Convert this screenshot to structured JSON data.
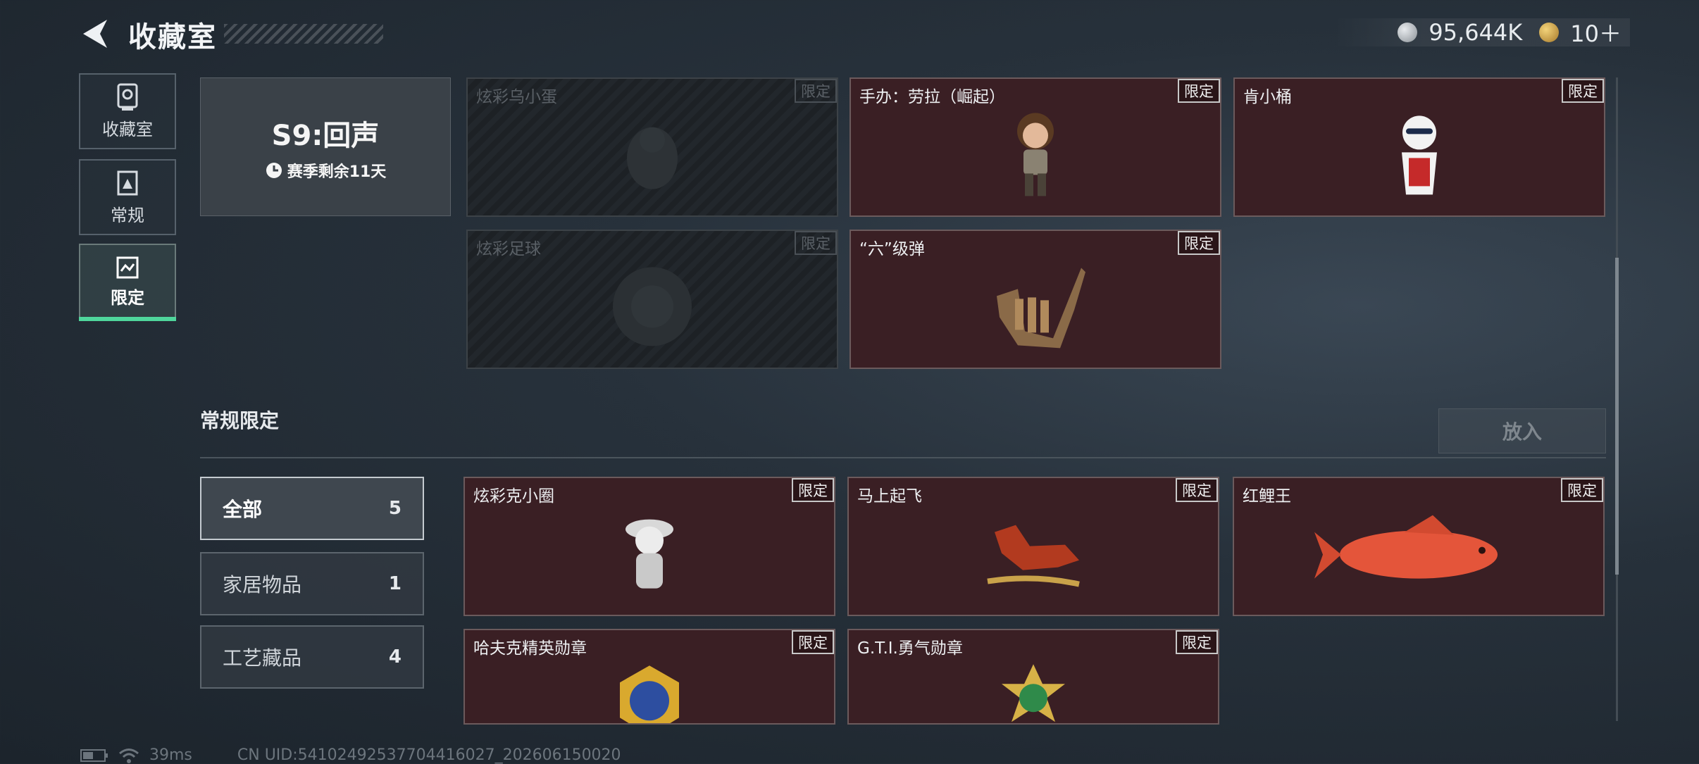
{
  "header": {
    "title": "收藏室",
    "currency": [
      {
        "icon": "silver-coin-icon",
        "value": "95,644K",
        "color": "#b8bcc0"
      },
      {
        "icon": "gold-coin-icon",
        "value": "10＋",
        "color": "#d4a94a"
      }
    ]
  },
  "sidebar": {
    "items": [
      {
        "label": "收藏室",
        "icon": "trophy-icon"
      },
      {
        "label": "常规",
        "icon": "card-icon"
      },
      {
        "label": "限定",
        "icon": "frame-icon"
      }
    ],
    "active_index": 2,
    "accent": "#4fd69c"
  },
  "season": {
    "title": "S9:回声",
    "remaining": "赛季剩余11天"
  },
  "season_items": [
    {
      "name": "炫彩乌小蛋",
      "tag": "限定",
      "locked": true
    },
    {
      "name": "手办：劳拉（崛起）",
      "tag": "限定",
      "locked": false
    },
    {
      "name": "肯小桶",
      "tag": "限定",
      "locked": false
    },
    {
      "name": "炫彩足球",
      "tag": "限定",
      "locked": true
    },
    {
      "name": "“六”级弹",
      "tag": "限定",
      "locked": false
    }
  ],
  "section": {
    "title": "常规限定",
    "put_button": "放入"
  },
  "filters": [
    {
      "label": "全部",
      "count": "5"
    },
    {
      "label": "家居物品",
      "count": "1"
    },
    {
      "label": "工艺藏品",
      "count": "4"
    }
  ],
  "regular_items": [
    {
      "name": "炫彩克小圈",
      "tag": "限定"
    },
    {
      "name": "马上起飞",
      "tag": "限定"
    },
    {
      "name": "红鲤王",
      "tag": "限定"
    },
    {
      "name": "哈夫克精英勋章",
      "tag": "限定"
    },
    {
      "name": "G.T.I.勇气勋章",
      "tag": "限定"
    }
  ],
  "footer": {
    "ping": "39ms",
    "uid": "CN UID:54102492537704416027_202606150020"
  }
}
